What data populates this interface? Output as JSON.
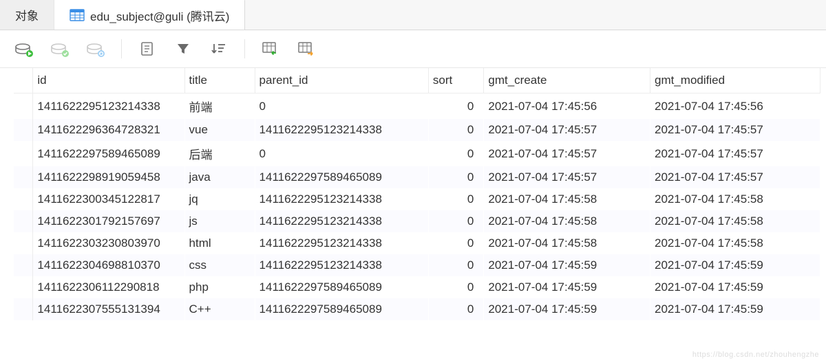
{
  "tabs": {
    "object_label": "对象",
    "active_label": "edu_subject@guli (腾讯云)"
  },
  "toolbar_icons": {
    "run": "run",
    "ok": "ok",
    "refresh": "refresh",
    "notes": "notes",
    "filter": "filter",
    "sort": "sort",
    "import": "import",
    "export": "export"
  },
  "columns": {
    "id": "id",
    "title": "title",
    "parent_id": "parent_id",
    "sort": "sort",
    "gmt_create": "gmt_create",
    "gmt_modified": "gmt_modified"
  },
  "rows": [
    {
      "id": "1411622295123214338",
      "title": "前端",
      "parent_id": "0",
      "sort": "0",
      "gc": "2021-07-04 17:45:56",
      "gm": "2021-07-04 17:45:56"
    },
    {
      "id": "1411622296364728321",
      "title": "vue",
      "parent_id": "1411622295123214338",
      "sort": "0",
      "gc": "2021-07-04 17:45:57",
      "gm": "2021-07-04 17:45:57"
    },
    {
      "id": "1411622297589465089",
      "title": "后端",
      "parent_id": "0",
      "sort": "0",
      "gc": "2021-07-04 17:45:57",
      "gm": "2021-07-04 17:45:57"
    },
    {
      "id": "1411622298919059458",
      "title": "java",
      "parent_id": "1411622297589465089",
      "sort": "0",
      "gc": "2021-07-04 17:45:57",
      "gm": "2021-07-04 17:45:57"
    },
    {
      "id": "1411622300345122817",
      "title": "jq",
      "parent_id": "1411622295123214338",
      "sort": "0",
      "gc": "2021-07-04 17:45:58",
      "gm": "2021-07-04 17:45:58"
    },
    {
      "id": "1411622301792157697",
      "title": "js",
      "parent_id": "1411622295123214338",
      "sort": "0",
      "gc": "2021-07-04 17:45:58",
      "gm": "2021-07-04 17:45:58"
    },
    {
      "id": "1411622303230803970",
      "title": "html",
      "parent_id": "1411622295123214338",
      "sort": "0",
      "gc": "2021-07-04 17:45:58",
      "gm": "2021-07-04 17:45:58"
    },
    {
      "id": "1411622304698810370",
      "title": "css",
      "parent_id": "1411622295123214338",
      "sort": "0",
      "gc": "2021-07-04 17:45:59",
      "gm": "2021-07-04 17:45:59"
    },
    {
      "id": "1411622306112290818",
      "title": "php",
      "parent_id": "1411622297589465089",
      "sort": "0",
      "gc": "2021-07-04 17:45:59",
      "gm": "2021-07-04 17:45:59"
    },
    {
      "id": "1411622307555131394",
      "title": "C++",
      "parent_id": "1411622297589465089",
      "sort": "0",
      "gc": "2021-07-04 17:45:59",
      "gm": "2021-07-04 17:45:59"
    }
  ],
  "watermark": "https://blog.csdn.net/zhouhengzhe"
}
